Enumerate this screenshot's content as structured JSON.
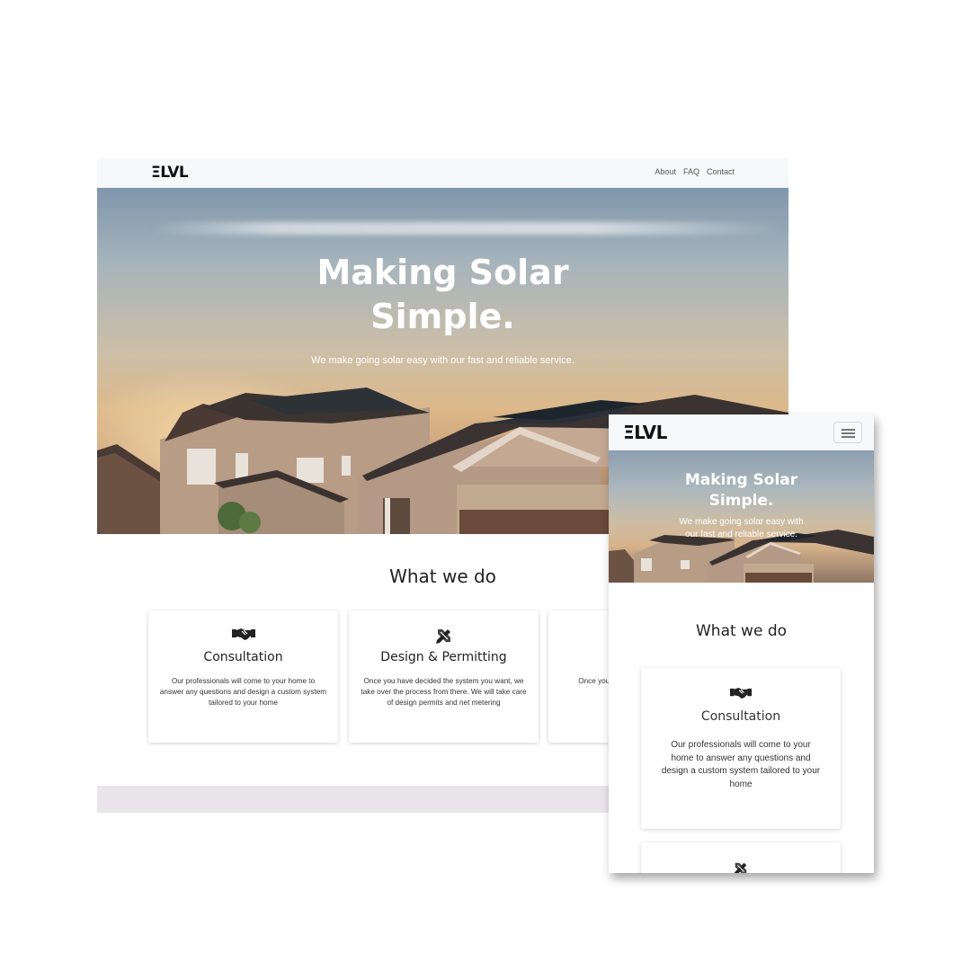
{
  "brand": {
    "logo": "ΞLVL"
  },
  "desktop": {
    "nav": {
      "links": [
        "About",
        "FAQ",
        "Contact"
      ]
    },
    "hero": {
      "title_line1": "Making Solar",
      "title_line2": "Simple.",
      "subtitle": "We make going solar easy with our fast and reliable service."
    },
    "section_title": "What we do",
    "cards": [
      {
        "icon": "handshake-icon",
        "title": "Consultation",
        "desc": "Our professionals will come to your home to answer any questions and design a custom system tailored to your home"
      },
      {
        "icon": "design-tools-icon",
        "title": "Design & Permitting",
        "desc": "Once you have decided the system you want, we take over the process from there. We will take care of design permits and net metering"
      },
      {
        "icon": "",
        "title": "",
        "desc": "Once your p city, we will sc help you get"
      }
    ]
  },
  "mobile": {
    "hero": {
      "title_line1": "Making Solar",
      "title_line2": "Simple.",
      "subtitle": "We make going solar easy with our fast and reliable service."
    },
    "section_title": "What we do",
    "cards": [
      {
        "icon": "handshake-icon",
        "title": "Consultation",
        "desc": "Our professionals will come to your home to answer any questions and design a custom system tailored to your home"
      },
      {
        "icon": "design-tools-icon"
      }
    ]
  },
  "colors": {
    "nav_bg": "#f7f8f9",
    "text_dark": "#222222",
    "hero_text": "#ffffff",
    "footer_band": "#e8e4ea"
  }
}
